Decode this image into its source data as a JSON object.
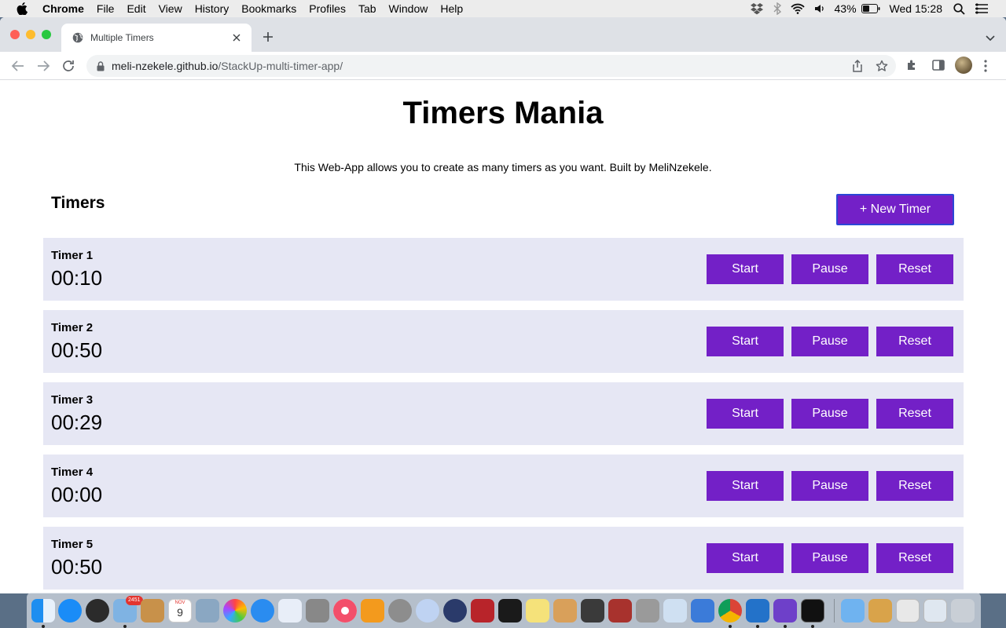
{
  "menubar": {
    "app_name": "Chrome",
    "items": [
      "File",
      "Edit",
      "View",
      "History",
      "Bookmarks",
      "Profiles",
      "Tab",
      "Window",
      "Help"
    ],
    "battery": "43%",
    "clock": "Wed 15:28"
  },
  "browser": {
    "tab_title": "Multiple Timers",
    "url_domain": "meli-nzekele.github.io",
    "url_path": "/StackUp-multi-timer-app/"
  },
  "page": {
    "title": "Timers Mania",
    "description": "This Web-App allows you to create as many timers as you want. Built by MeliNzekele.",
    "section_title": "Timers",
    "new_timer_label": "+ New Timer",
    "start_label": "Start",
    "pause_label": "Pause",
    "reset_label": "Reset",
    "timers": [
      {
        "name": "Timer 1",
        "time": "00:10"
      },
      {
        "name": "Timer 2",
        "time": "00:50"
      },
      {
        "name": "Timer 3",
        "time": "00:29"
      },
      {
        "name": "Timer 4",
        "time": "00:00"
      },
      {
        "name": "Timer 5",
        "time": "00:50"
      }
    ]
  },
  "colors": {
    "accent": "#7320c7",
    "row_background": "#e6e7f4",
    "new_timer_border": "#2b47d6"
  },
  "dock": {
    "calendar_month": "NOV",
    "calendar_day": "9",
    "notification_badge": "2451"
  }
}
